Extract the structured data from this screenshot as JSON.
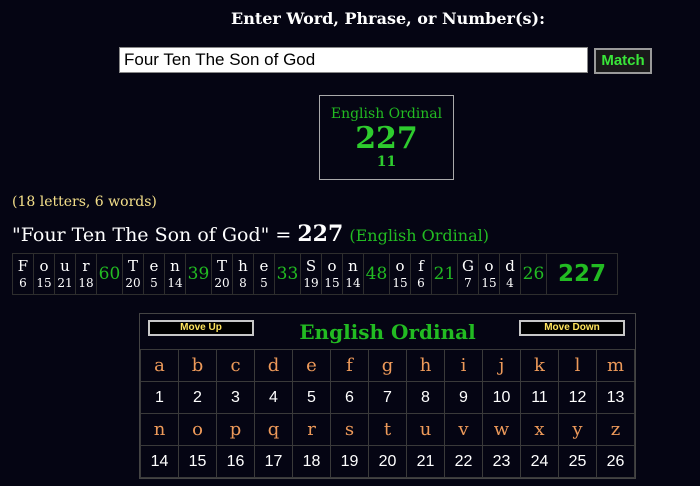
{
  "header": {
    "prompt": "Enter Word, Phrase, or Number(s):"
  },
  "search": {
    "value": "Four Ten The Son of God",
    "button_label": "Match"
  },
  "result": {
    "cipher": "English Ordinal",
    "value": "227",
    "reduction": "11"
  },
  "letter_count": "(18 letters, 6 words)",
  "summary": {
    "phrase": "\"Four Ten The Son of God\"",
    "equals": " = ",
    "value": "227",
    "cipher": "(English Ordinal)"
  },
  "breakdown": {
    "words": [
      {
        "letters": [
          "F",
          "o",
          "u",
          "r"
        ],
        "values": [
          "6",
          "15",
          "21",
          "18"
        ],
        "total": "60"
      },
      {
        "letters": [
          "T",
          "e",
          "n"
        ],
        "values": [
          "20",
          "5",
          "14"
        ],
        "total": "39"
      },
      {
        "letters": [
          "T",
          "h",
          "e"
        ],
        "values": [
          "20",
          "8",
          "5"
        ],
        "total": "33"
      },
      {
        "letters": [
          "S",
          "o",
          "n"
        ],
        "values": [
          "19",
          "15",
          "14"
        ],
        "total": "48"
      },
      {
        "letters": [
          "o",
          "f"
        ],
        "values": [
          "15",
          "6"
        ],
        "total": "21"
      },
      {
        "letters": [
          "G",
          "o",
          "d"
        ],
        "values": [
          "7",
          "15",
          "4"
        ],
        "total": "26"
      }
    ],
    "grand_total": "227"
  },
  "cipher_panel": {
    "title": "English Ordinal",
    "move_up": "Move Up",
    "move_down": "Move Down",
    "rows": [
      {
        "letters": [
          "a",
          "b",
          "c",
          "d",
          "e",
          "f",
          "g",
          "h",
          "i",
          "j",
          "k",
          "l",
          "m"
        ],
        "values": [
          "1",
          "2",
          "3",
          "4",
          "5",
          "6",
          "7",
          "8",
          "9",
          "10",
          "11",
          "12",
          "13"
        ]
      },
      {
        "letters": [
          "n",
          "o",
          "p",
          "q",
          "r",
          "s",
          "t",
          "u",
          "v",
          "w",
          "x",
          "y",
          "z"
        ],
        "values": [
          "14",
          "15",
          "16",
          "17",
          "18",
          "19",
          "20",
          "21",
          "22",
          "23",
          "24",
          "25",
          "26"
        ]
      }
    ]
  },
  "colors": {
    "background": "#050513",
    "accent_green": "#22bb22",
    "letter_orange": "#ee9a5a",
    "button_yellow": "#ffe45c",
    "count_yellow": "#f5e08a"
  }
}
